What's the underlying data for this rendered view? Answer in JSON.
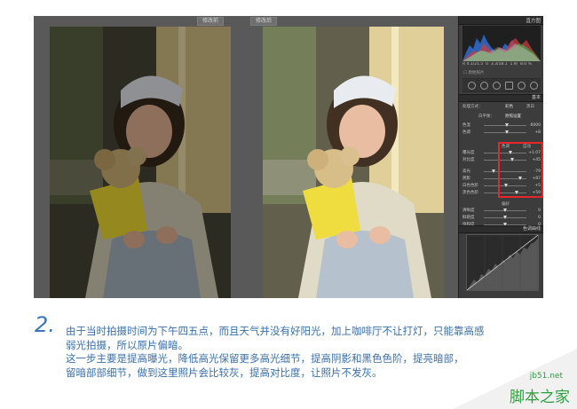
{
  "screenshot": {
    "tabs": [
      "修改前",
      "修改后"
    ],
    "panel": {
      "histogram_title": "直方图",
      "histogram_readout": [
        "R 4.1/21.5",
        "0",
        "3.3/18.1",
        "1.9/",
        "8.0 %"
      ],
      "original_photo_label": "原始照片",
      "basic_title": "基本",
      "treatment_label": "处理方式：",
      "treatment_options": [
        "彩色",
        "黑白"
      ],
      "wb_label": "白平衡：",
      "wb_value": "原照设置",
      "temp_rows": [
        {
          "name": "色温",
          "value": "6000"
        },
        {
          "name": "色调",
          "value": "+8"
        }
      ],
      "tone_label": "色调",
      "auto_label": "自动",
      "adjustments": [
        {
          "name": "曝光度",
          "value": "+1.07",
          "level": 0.62
        },
        {
          "name": "对比度",
          "value": "+45",
          "level": 0.66
        },
        {
          "name": "高光",
          "value": "-79",
          "level": 0.22
        },
        {
          "name": "阴影",
          "value": "+87",
          "level": 0.86
        },
        {
          "name": "白色色阶",
          "value": "+5",
          "level": 0.53
        },
        {
          "name": "黑色色阶",
          "value": "+59",
          "level": 0.78
        }
      ],
      "presence_label": "偏好",
      "presence_rows": [
        {
          "name": "清晰度",
          "value": "0"
        },
        {
          "name": "鲜艳度",
          "value": "0"
        },
        {
          "name": "饱和度",
          "value": "0"
        }
      ],
      "curve_title": "色调曲线"
    }
  },
  "step": {
    "number": "2.",
    "lines": [
      "由于当时拍摄时间为下午四五点，而且天气并没有好阳光，加上咖啡厅不让打灯，只能靠高感",
      "弱光拍摄，所以原片偏暗。",
      "这一步主要是提高曝光，降低高光保留更多高光细节，提高阴影和黑色色阶，提亮暗部，",
      "留暗部部细节，做到这里照片会比较灰，提高对比度，让照片不发灰。"
    ]
  },
  "watermark": {
    "url": "jb51.net",
    "name": "脚本之家"
  },
  "colors": {
    "accent_text": "#3a6fa8",
    "highlight_box": "#e8262a",
    "watermark": "#2f9e3e"
  }
}
